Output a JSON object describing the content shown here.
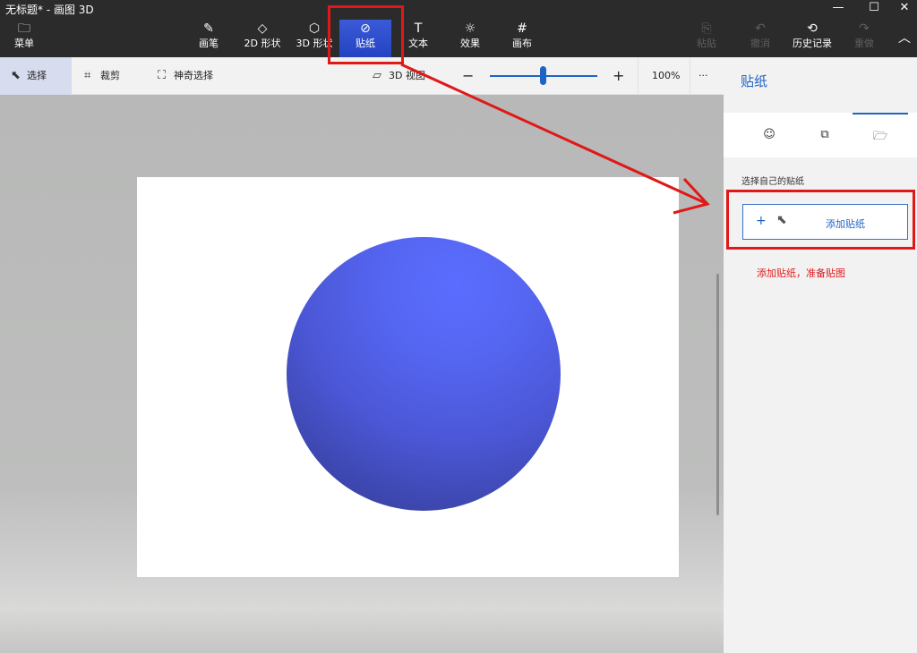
{
  "app": {
    "title": "无标题* - 画图 3D"
  },
  "window_controls": {
    "minimize": "—",
    "maximize": "☐",
    "close": "✕"
  },
  "ribbon": {
    "menu": "菜单",
    "brushes": "画笔",
    "shapes_2d": "2D 形状",
    "shapes_3d": "3D 形状",
    "stickers": "贴纸",
    "text": "文本",
    "effects": "效果",
    "canvas": "画布",
    "paste": "粘贴",
    "undo": "撤消",
    "history": "历史记录",
    "redo": "重做"
  },
  "toolbar": {
    "select": "选择",
    "crop": "裁剪",
    "magic_select": "神奇选择",
    "view_3d": "3D 视图",
    "zoom_out": "−",
    "zoom_in": "+",
    "zoom": "100%",
    "more": "···",
    "zoom_level": 0.5
  },
  "panel": {
    "title": "贴纸",
    "section_label": "选择自己的贴纸",
    "add_button": "添加贴纸",
    "plus": "+",
    "annotation": "添加贴纸，准备贴图"
  },
  "colors": {
    "accent": "#1f64c4",
    "active_tab": "#2343c2",
    "annotation": "#e01818",
    "sphere": "#4b57d6"
  }
}
